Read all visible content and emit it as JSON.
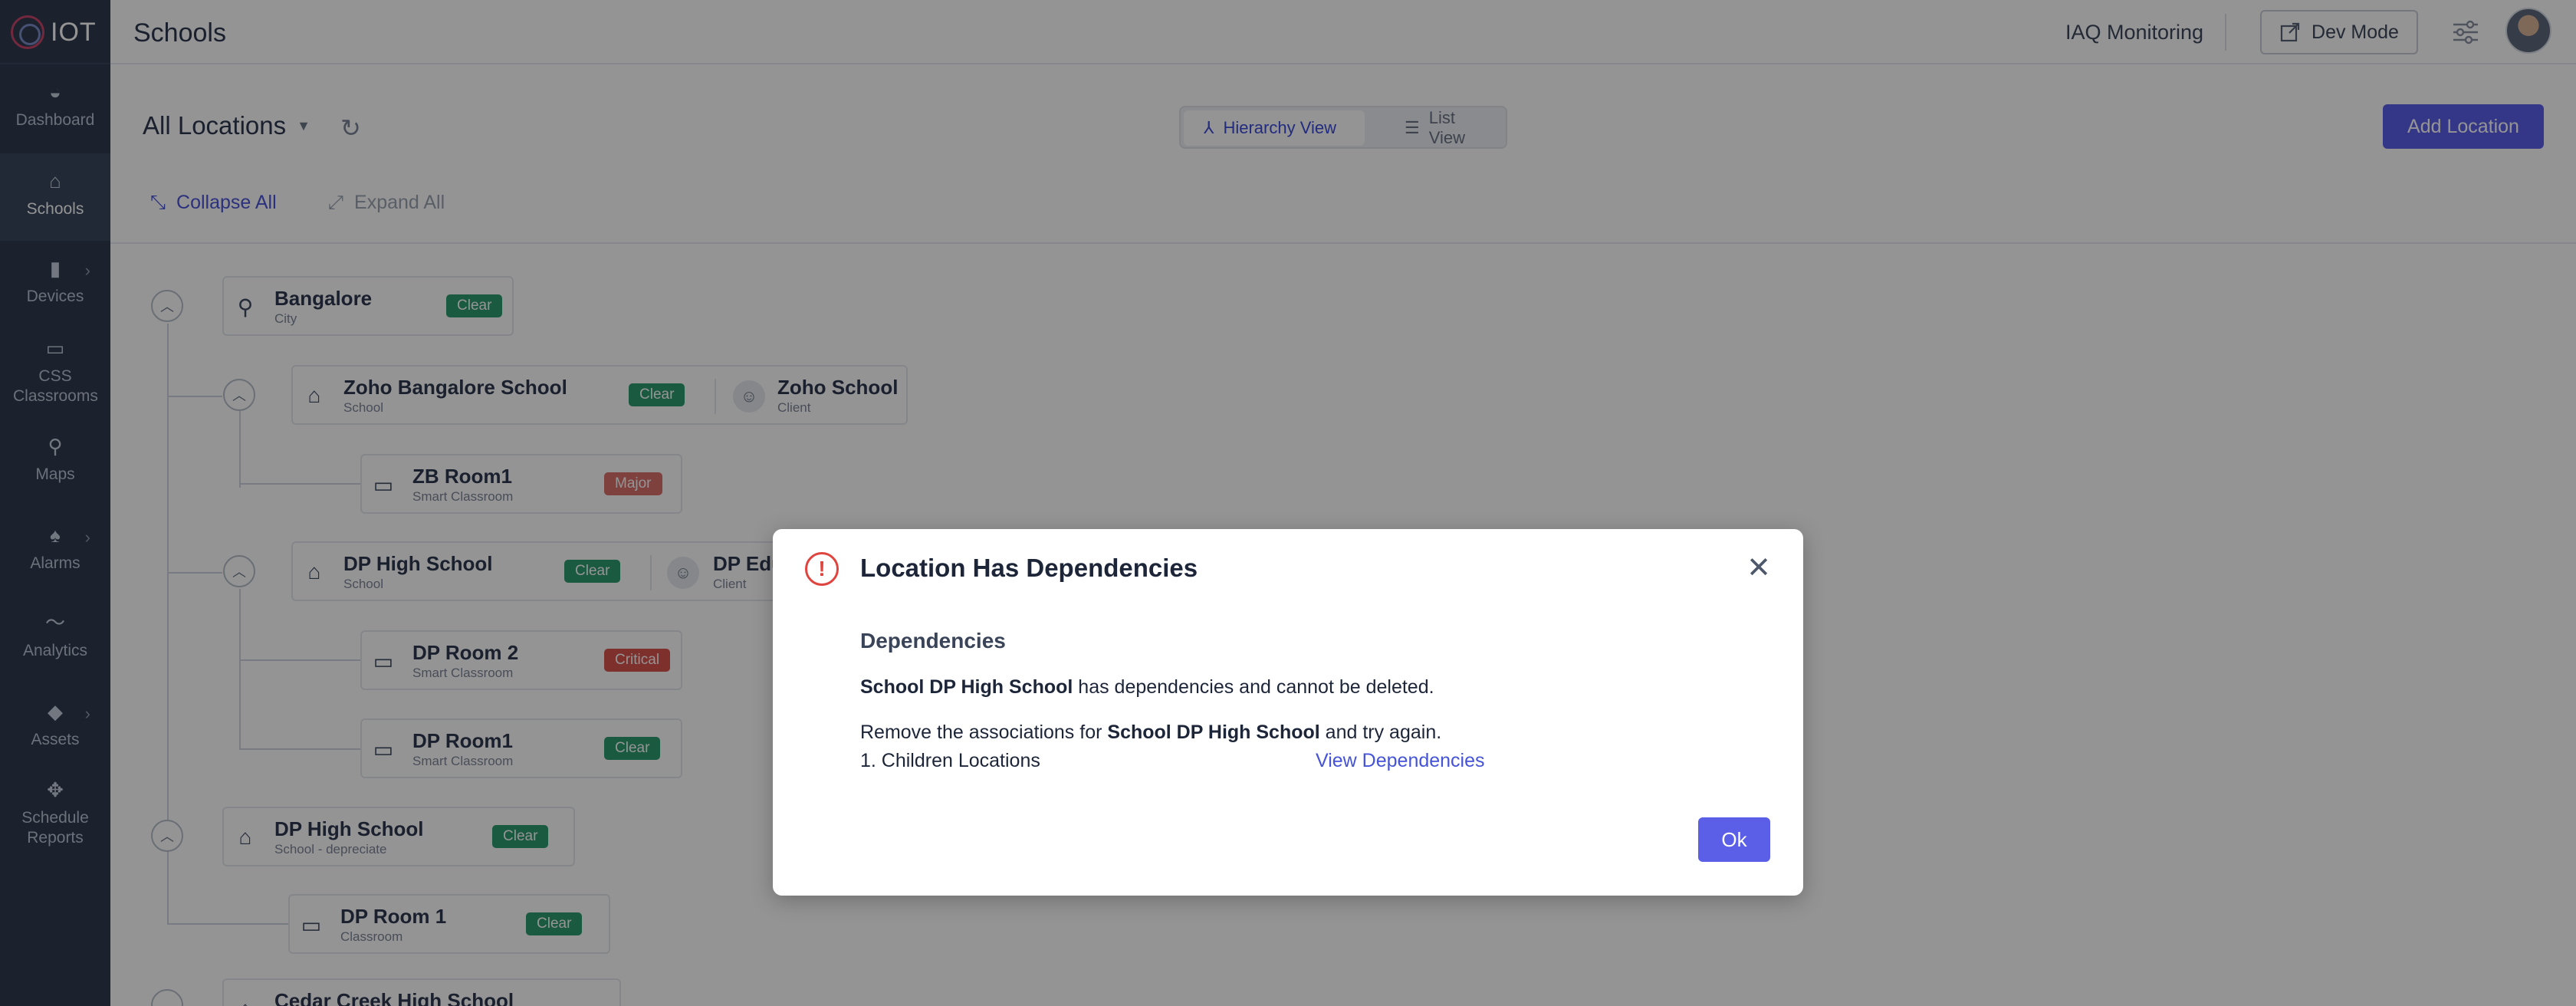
{
  "app": {
    "logo_text": "IOT"
  },
  "sidebar": {
    "items": [
      {
        "label": "Dashboard",
        "icon": "dashboard-icon"
      },
      {
        "label": "Schools",
        "icon": "school-icon",
        "active": true
      },
      {
        "label": "Devices",
        "icon": "device-icon"
      },
      {
        "label": "CSS Classrooms",
        "icon": "classroom-icon"
      },
      {
        "label": "Maps",
        "icon": "map-pin-icon"
      },
      {
        "label": "Alarms",
        "icon": "bell-icon"
      },
      {
        "label": "Analytics",
        "icon": "analytics-icon"
      },
      {
        "label": "Assets",
        "icon": "asset-icon"
      },
      {
        "label": "Schedule Reports",
        "icon": "schedule-icon"
      }
    ]
  },
  "header": {
    "title": "Schools",
    "iaq_label": "IAQ Monitoring",
    "dev_mode_label": "Dev Mode"
  },
  "toolbar": {
    "locations_title": "All Locations",
    "hierarchy_view_label": "Hierarchy View",
    "list_view_label": "List View",
    "add_location_label": "Add Location",
    "collapse_all_label": "Collapse All",
    "expand_all_label": "Expand All"
  },
  "tree": {
    "nodes": [
      {
        "name": "Bangalore",
        "type": "City",
        "status": "Clear"
      },
      {
        "name": "Zoho Bangalore School",
        "type": "School",
        "status": "Clear",
        "client_name": "Zoho School",
        "client_type": "Client"
      },
      {
        "name": "ZB Room1",
        "type": "Smart Classroom",
        "status": "Major"
      },
      {
        "name": "DP High School",
        "type": "School",
        "status": "Clear",
        "client_name": "DP Edu",
        "client_type": "Client"
      },
      {
        "name": "DP Room 2",
        "type": "Smart Classroom",
        "status": "Critical"
      },
      {
        "name": "DP Room1",
        "type": "Smart Classroom",
        "status": "Clear"
      },
      {
        "name": "DP High School",
        "type": "School - depreciate",
        "status": "Clear"
      },
      {
        "name": "DP Room 1",
        "type": "Classroom",
        "status": "Clear"
      },
      {
        "name": "Cedar Creek High School",
        "type": "",
        "status": ""
      }
    ]
  },
  "modal": {
    "title": "Location Has Dependencies",
    "section_heading": "Dependencies",
    "line1_bold": "School DP High School",
    "line1_rest": " has dependencies and cannot be deleted.",
    "line2_prefix": "Remove the associations for ",
    "line2_bold": "School DP High School",
    "line2_suffix": " and try again.",
    "dependency_item": "1. Children Locations",
    "view_dependencies_label": "View Dependencies",
    "ok_label": "Ok"
  },
  "colors": {
    "sidebar_bg": "#2f3b4f",
    "primary": "#5b5fe8",
    "clear": "#2e9b6f",
    "major": "#d9706a",
    "critical": "#d9534f",
    "error": "#e0443e"
  }
}
